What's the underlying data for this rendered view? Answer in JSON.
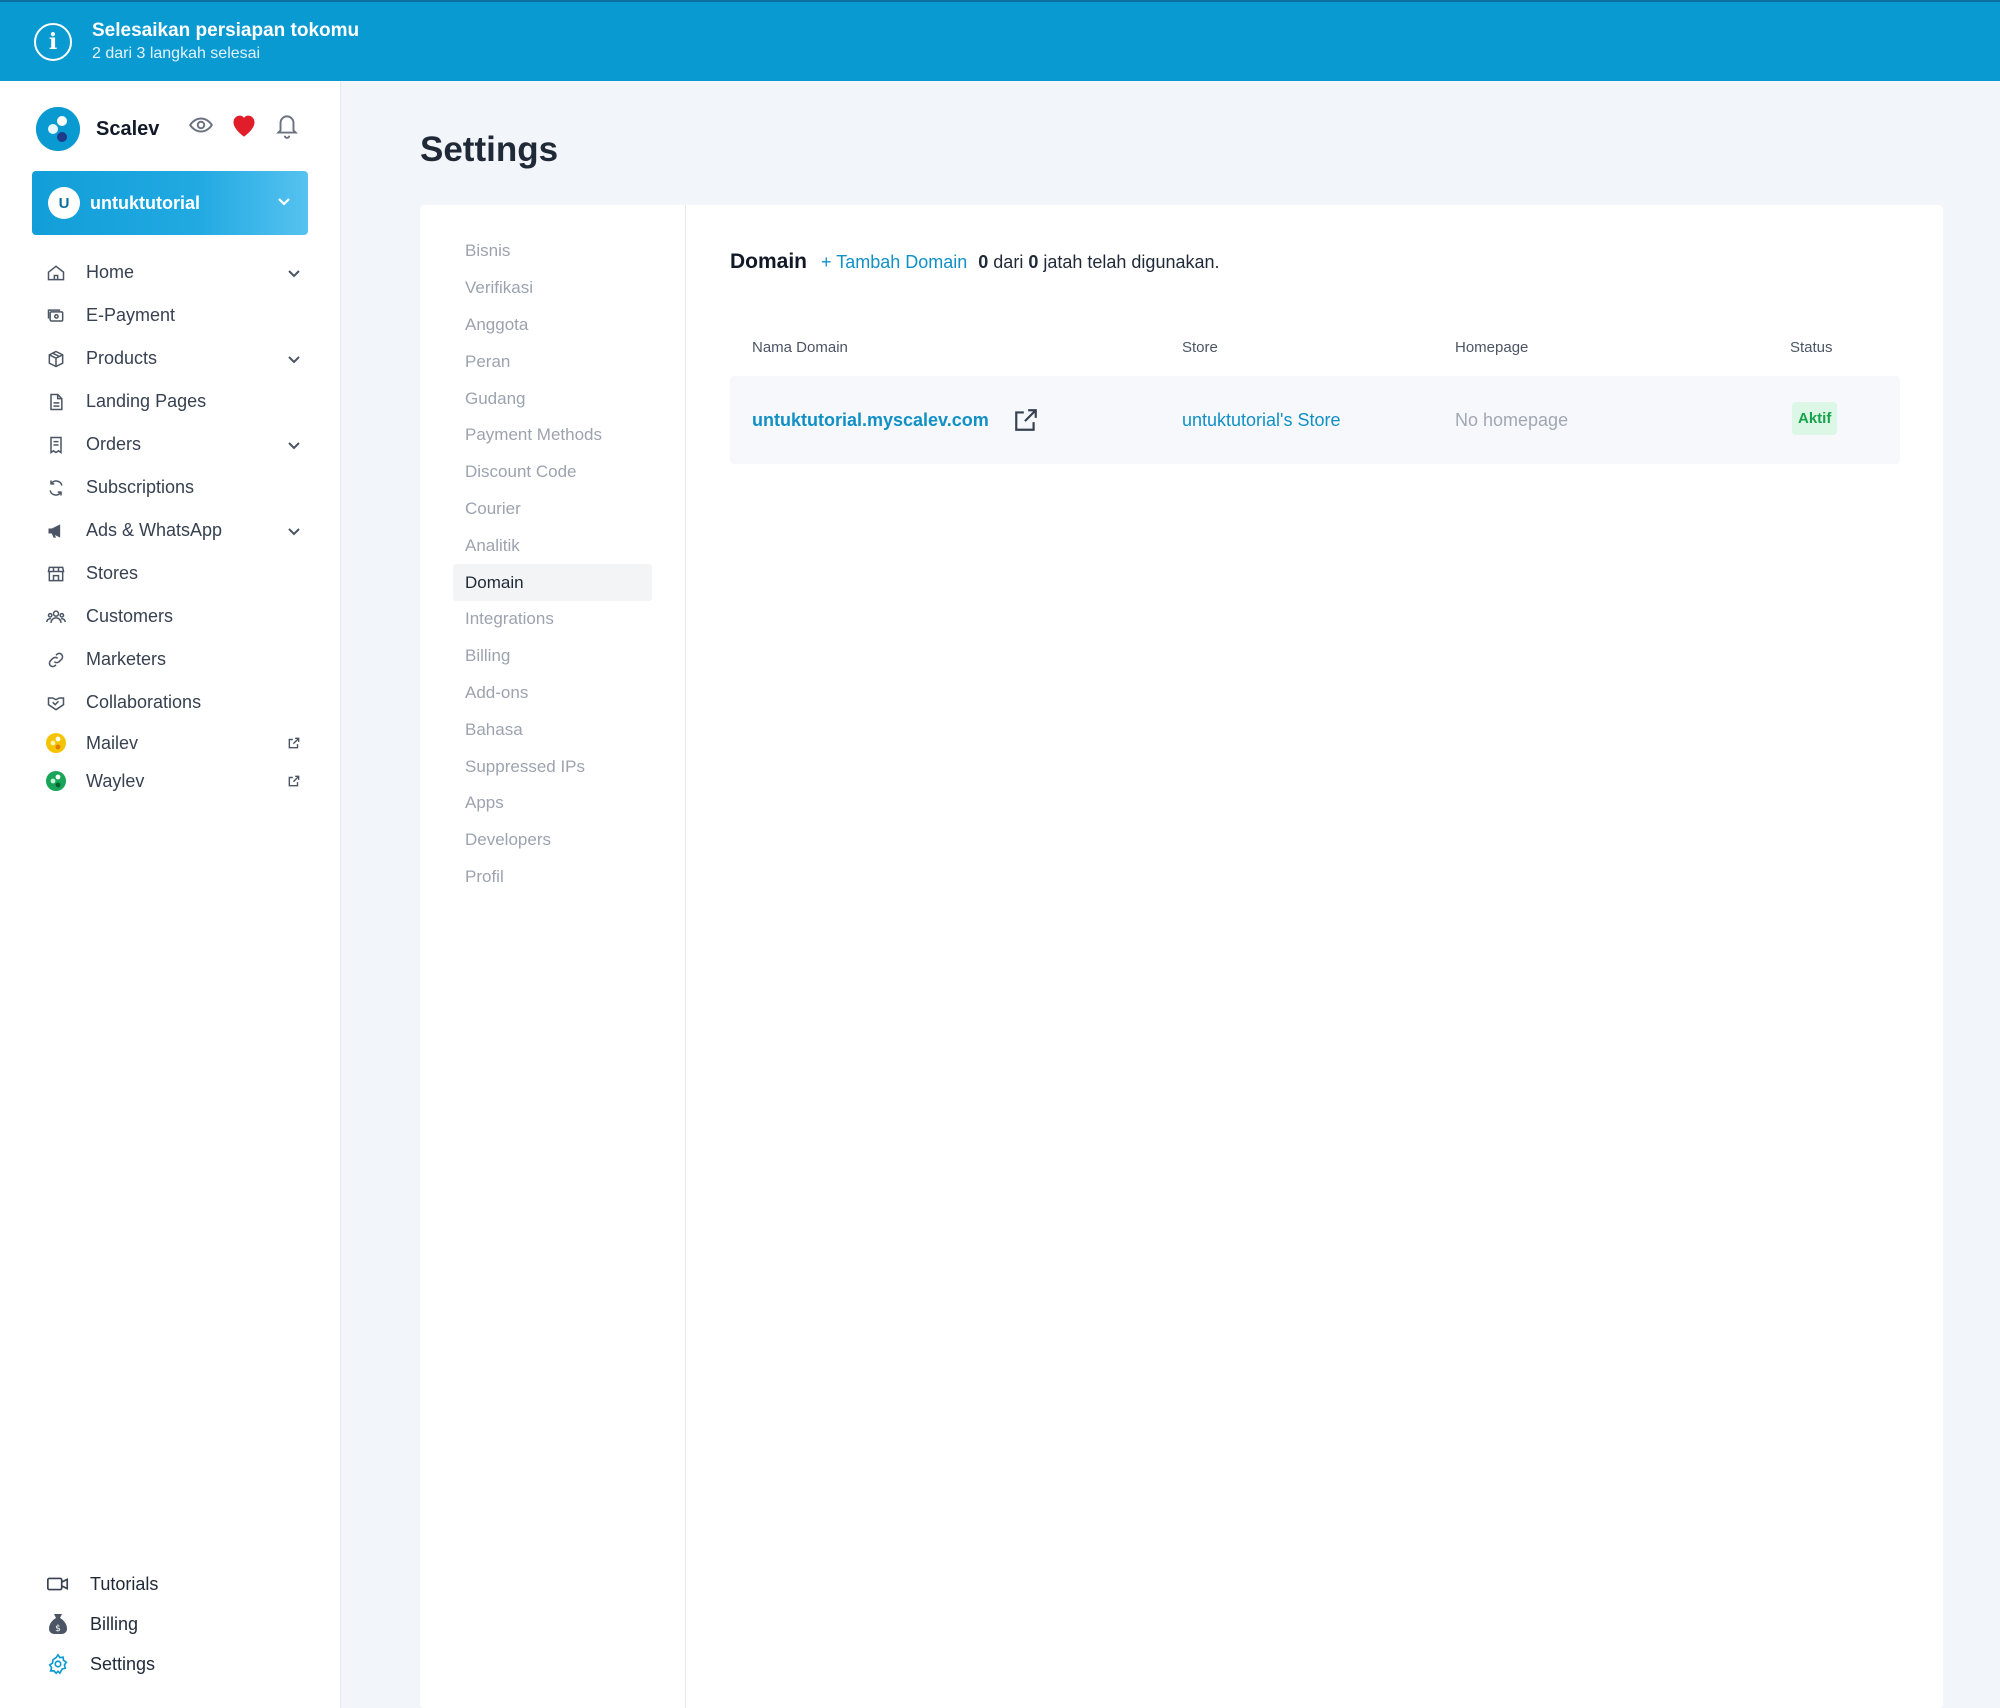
{
  "banner": {
    "title": "Selesaikan persiapan tokomu",
    "subtitle": "2 dari 3 langkah selesai"
  },
  "brand": {
    "name": "Scalev"
  },
  "store": {
    "avatar": "U",
    "name": "untuktutorial"
  },
  "nav": {
    "items": [
      {
        "label": "Home"
      },
      {
        "label": "E-Payment"
      },
      {
        "label": "Products"
      },
      {
        "label": "Landing Pages"
      },
      {
        "label": "Orders"
      },
      {
        "label": "Subscriptions"
      },
      {
        "label": "Ads & WhatsApp"
      },
      {
        "label": "Stores"
      },
      {
        "label": "Customers"
      },
      {
        "label": "Marketers"
      },
      {
        "label": "Collaborations"
      },
      {
        "label": "Mailev"
      },
      {
        "label": "Waylev"
      }
    ]
  },
  "bottom_nav": {
    "items": [
      {
        "label": "Tutorials"
      },
      {
        "label": "Billing"
      },
      {
        "label": "Settings"
      }
    ]
  },
  "page": {
    "title": "Settings"
  },
  "settings_nav": {
    "items": [
      {
        "label": "Bisnis"
      },
      {
        "label": "Verifikasi"
      },
      {
        "label": "Anggota"
      },
      {
        "label": "Peran"
      },
      {
        "label": "Gudang"
      },
      {
        "label": "Payment Methods"
      },
      {
        "label": "Discount Code"
      },
      {
        "label": "Courier"
      },
      {
        "label": "Analitik"
      },
      {
        "label": "Domain"
      },
      {
        "label": "Integrations"
      },
      {
        "label": "Billing"
      },
      {
        "label": "Add-ons"
      },
      {
        "label": "Bahasa"
      },
      {
        "label": "Suppressed IPs"
      },
      {
        "label": "Apps"
      },
      {
        "label": "Developers"
      },
      {
        "label": "Profil"
      }
    ],
    "active": "Domain"
  },
  "domain": {
    "heading": "Domain",
    "add_label": "+ Tambah Domain",
    "quota_used": "0",
    "quota_of": "dari",
    "quota_total": "0",
    "quota_suffix": "jatah telah digunakan.",
    "columns": [
      "Nama Domain",
      "Store",
      "Homepage",
      "Status"
    ],
    "rows": [
      {
        "domain": "untuktutorial.myscalev.com",
        "store": "untuktutorial's Store",
        "homepage": "No homepage",
        "status": "Aktif"
      }
    ]
  },
  "colors": {
    "banner": "#0a9ad2",
    "accent": "#1190c6",
    "status_active_bg": "#dcf7e6",
    "status_active_text": "#16a34a"
  }
}
